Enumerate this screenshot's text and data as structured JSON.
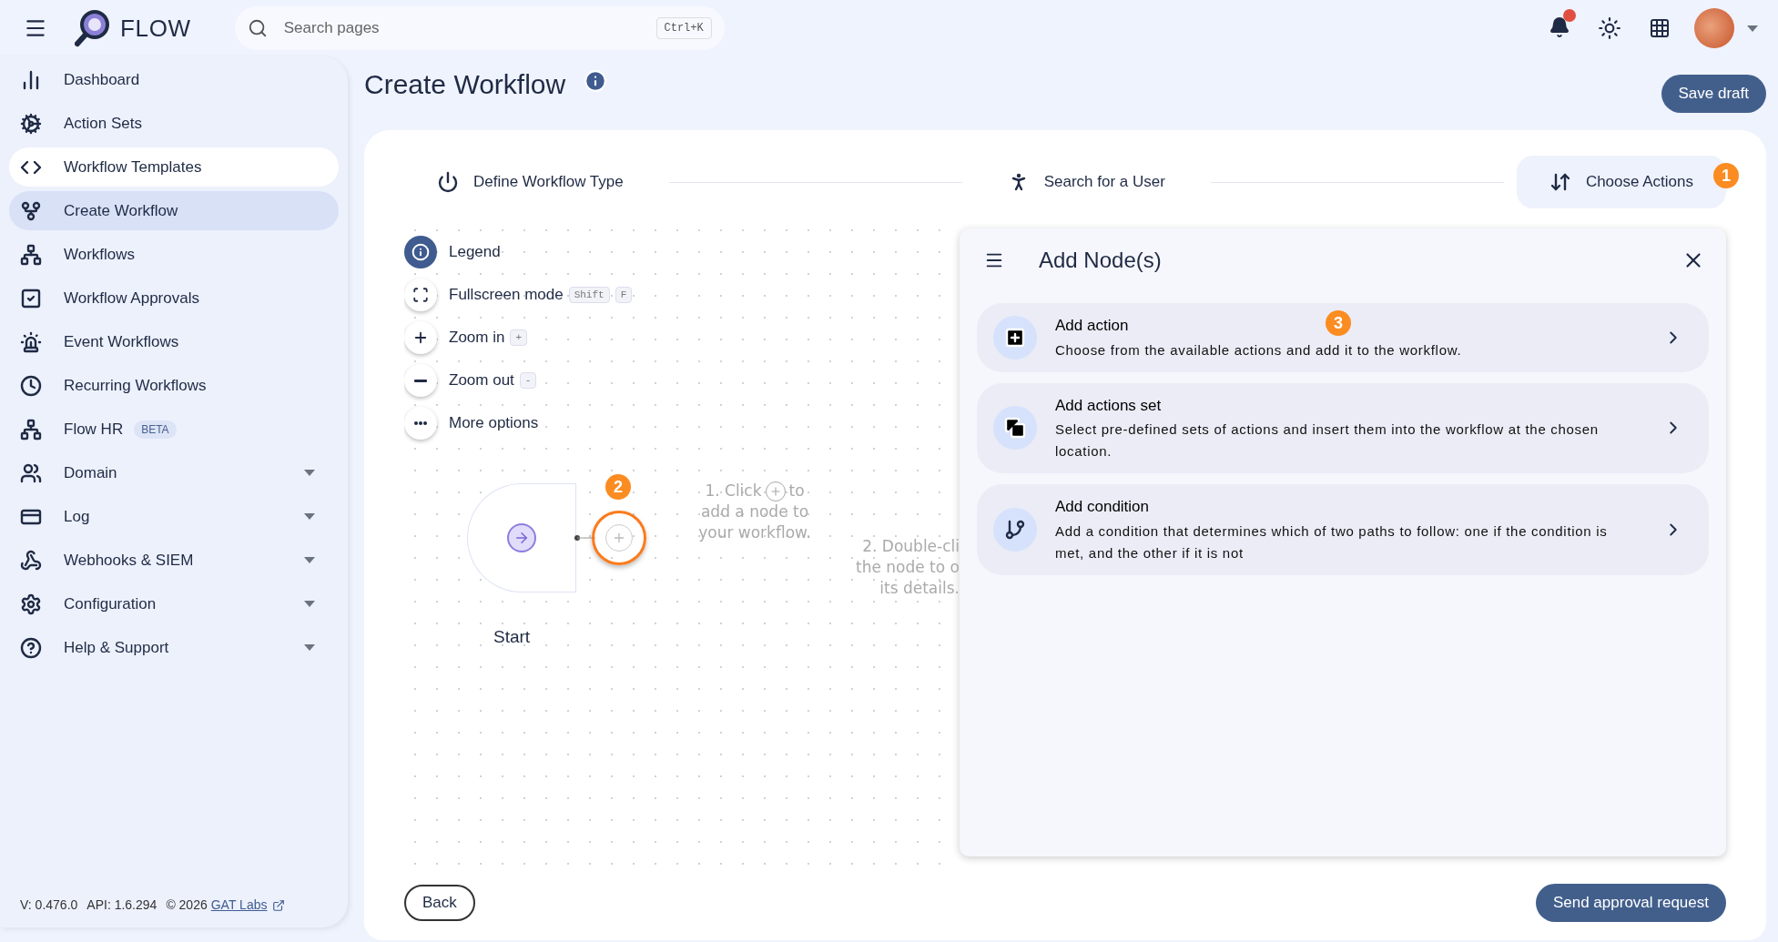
{
  "header": {
    "app_name": "FLOW",
    "search": {
      "placeholder": "Search pages",
      "shortcut": "Ctrl+K"
    },
    "has_notifications": true
  },
  "sidebar": {
    "items": [
      {
        "label": "Dashboard",
        "selected": false,
        "expandable": false
      },
      {
        "label": "Action Sets",
        "selected": false,
        "expandable": false
      },
      {
        "label": "Workflow Templates",
        "selected": false,
        "hovered": true,
        "expandable": false
      },
      {
        "label": "Create Workflow",
        "selected": true,
        "expandable": false
      },
      {
        "label": "Workflows",
        "selected": false,
        "expandable": false
      },
      {
        "label": "Workflow Approvals",
        "selected": false,
        "expandable": false
      },
      {
        "label": "Event Workflows",
        "selected": false,
        "expandable": false
      },
      {
        "label": "Recurring Workflows",
        "selected": false,
        "expandable": false
      },
      {
        "label": "Flow HR",
        "selected": false,
        "expandable": false,
        "badge": "BETA"
      },
      {
        "label": "Domain",
        "selected": false,
        "expandable": true
      },
      {
        "label": "Log",
        "selected": false,
        "expandable": true
      },
      {
        "label": "Webhooks & SIEM",
        "selected": false,
        "expandable": true
      },
      {
        "label": "Configuration",
        "selected": false,
        "expandable": true
      },
      {
        "label": "Help & Support",
        "selected": false,
        "expandable": true
      }
    ],
    "footer": {
      "version": "V: 0.476.0",
      "api": "API: 1.6.294",
      "copyright": "© 2026",
      "link": "GAT Labs"
    }
  },
  "page": {
    "title": "Create Workflow",
    "save_button": "Save draft"
  },
  "stepper": {
    "steps": [
      {
        "label": "Define Workflow Type",
        "selected": false
      },
      {
        "label": "Search for a User",
        "selected": false
      },
      {
        "label": "Choose Actions",
        "selected": true,
        "callout": "1"
      }
    ]
  },
  "canvas": {
    "controls": [
      {
        "kind": "legend",
        "label": "Legend"
      },
      {
        "kind": "fullscreen",
        "label": "Fullscreen mode",
        "keys": [
          "Shift",
          "F"
        ]
      },
      {
        "kind": "zoom_in",
        "label": "Zoom in",
        "keys": [
          "+"
        ]
      },
      {
        "kind": "zoom_out",
        "label": "Zoom out",
        "keys": [
          "-"
        ]
      },
      {
        "kind": "more",
        "label": "More options"
      }
    ],
    "start_node": {
      "label": "Start",
      "callout": "2"
    },
    "hint_1": {
      "before": "1. Click",
      "after": "to",
      "lines": [
        "add a node to",
        "your workflow."
      ]
    },
    "hint_2": {
      "lines": [
        "2. Double-cli",
        "the node to o",
        "its details."
      ]
    }
  },
  "panel": {
    "title": "Add Node(s)",
    "options": [
      {
        "kind": "action",
        "title": "Add action",
        "description": "Choose from the available actions and add it to the workflow.",
        "callout": "3"
      },
      {
        "kind": "set",
        "title": "Add actions set",
        "description": "Select pre-defined sets of actions and insert them into the workflow at the chosen location."
      },
      {
        "kind": "condition",
        "title": "Add condition",
        "description": "Add a condition that determines which of two paths to follow: one if the condition is met, and the other if it is not"
      }
    ]
  },
  "footer_buttons": {
    "back": "Back",
    "submit": "Send approval request"
  }
}
